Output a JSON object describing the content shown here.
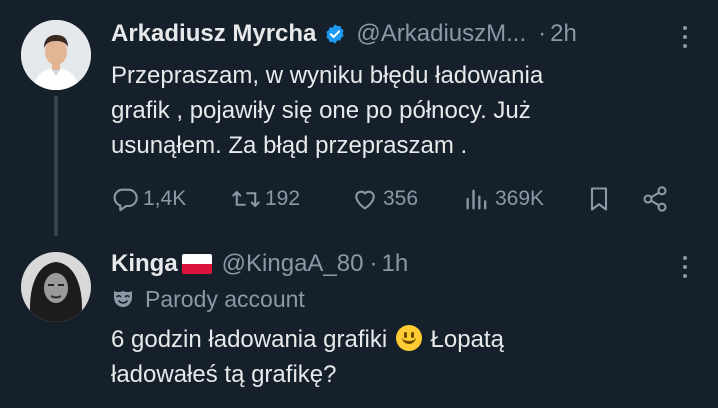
{
  "tweet1": {
    "author_name": "Arkadiusz Myrcha",
    "handle": "@ArkadiuszM...",
    "separator": "·",
    "time": "2h",
    "text_lines": [
      "Przepraszam, w wyniku błędu ładowania",
      "grafik , pojawiły się one po północy. Już",
      "usunąłem. Za błąd przepraszam ."
    ],
    "replies": "1,4K",
    "reposts": "192",
    "likes": "356",
    "views": "369K",
    "verified": true
  },
  "tweet2": {
    "author_name": "Kinga",
    "handle": "@KingaA_80",
    "separator": "·",
    "time": "1h",
    "parody_label": "Parody account",
    "text_line1_before": "6 godzin ładowania grafiki",
    "text_line1_after": "Łopatą",
    "text_line2": "ładowałeś tą grafikę?",
    "emoji": "smiling-face"
  },
  "colors": {
    "background": "#15202b",
    "text_primary": "#e7e9ea",
    "text_secondary": "#8b98a5",
    "verified_blue": "#1d9bf0",
    "thread_line": "#38444d"
  },
  "icons": [
    "verified-badge-icon",
    "more-options-icon",
    "reply-icon",
    "repost-icon",
    "like-icon",
    "views-icon",
    "bookmark-icon",
    "share-icon",
    "parody-mask-icon",
    "poland-flag-icon"
  ]
}
